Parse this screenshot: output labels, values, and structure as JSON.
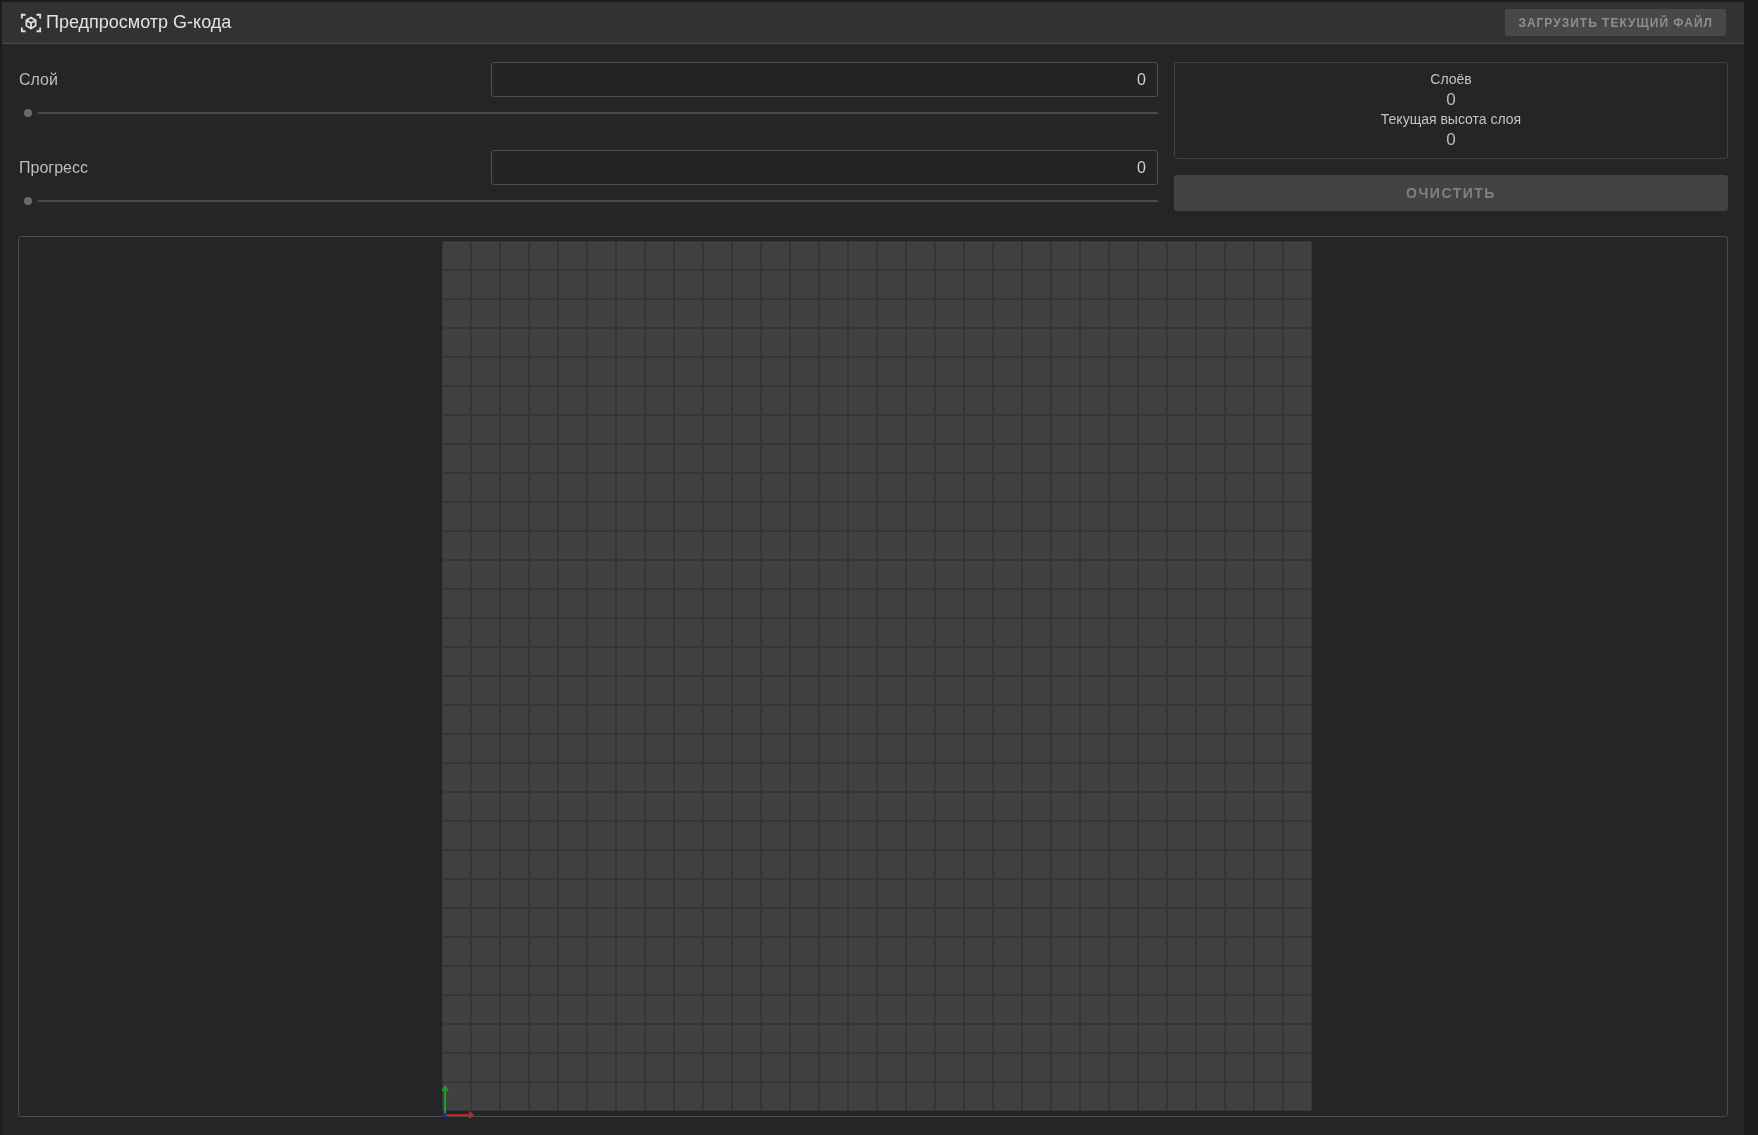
{
  "header": {
    "title": "Предпросмотр G-кода",
    "load_button": "ЗАГРУЗИТЬ ТЕКУЩИЙ ФАЙЛ"
  },
  "controls": [
    {
      "label": "Слой",
      "value": "0",
      "level": 0
    },
    {
      "label": "Прогресс",
      "value": "0",
      "level": 0
    }
  ],
  "stats": [
    {
      "label": "Слоёв",
      "value": "0"
    },
    {
      "label": "Текущая высота слоя",
      "value": "0"
    }
  ],
  "clear_button": "ОЧИСТИТЬ"
}
